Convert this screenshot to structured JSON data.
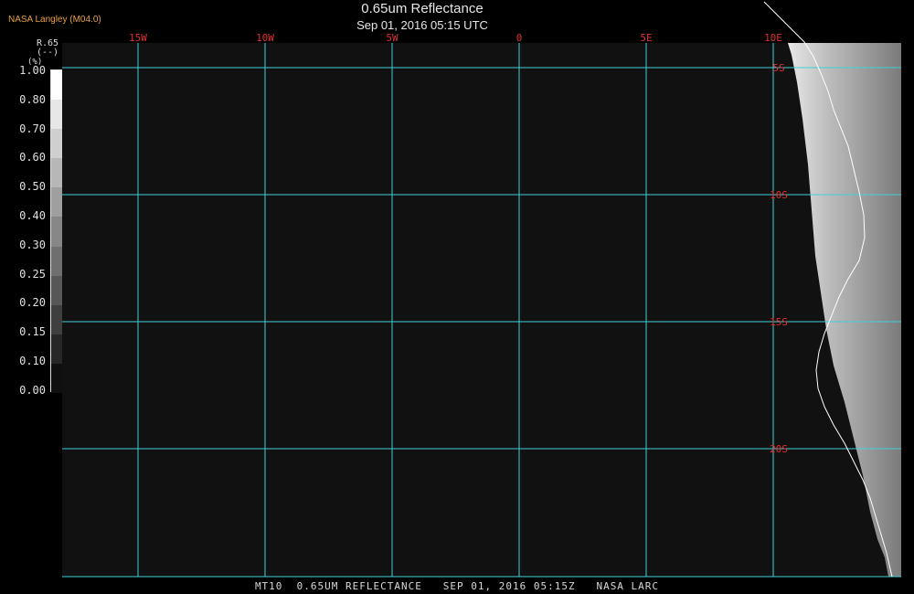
{
  "header": {
    "credit": "NASA Langley (M04.0)",
    "title": "0.65um Reflectance",
    "subtitle": "Sep 01, 2016 05:15 UTC"
  },
  "footer": {
    "text": "MT10  0.65UM REFLECTANCE   SEP 01, 2016 05:15Z   NASA LARC"
  },
  "legend": {
    "label_line1": "R.65",
    "label_line2": "(--)",
    "label_line3": "(%)",
    "ticks": [
      "1.00",
      "0.80",
      "0.70",
      "0.60",
      "0.50",
      "0.40",
      "0.30",
      "0.25",
      "0.20",
      "0.15",
      "0.10",
      "0.00"
    ]
  },
  "map": {
    "lon_labels": [
      "15W",
      "10W",
      "5W",
      "0",
      "5E",
      "10E"
    ],
    "lon_values": [
      -15,
      -10,
      -5,
      0,
      5,
      10
    ],
    "lat_labels": [
      "5S",
      "10S",
      "15S",
      "20S"
    ],
    "lat_values": [
      -5,
      -10,
      -15,
      -20
    ],
    "colors": {
      "grid": "#3fd0d8",
      "labels": "#e03030",
      "ocean": "#111111",
      "coast": "#ffffff"
    }
  }
}
